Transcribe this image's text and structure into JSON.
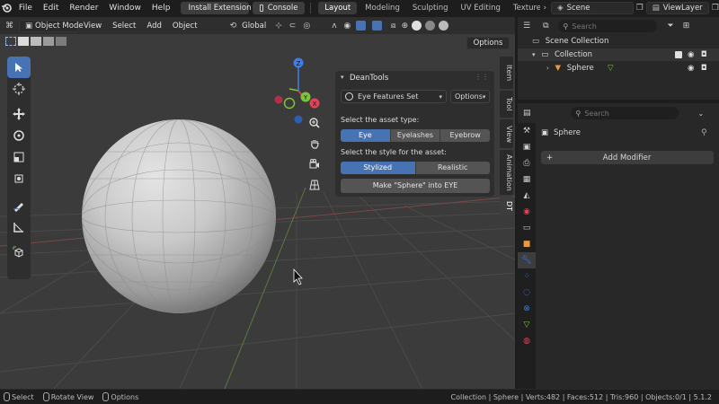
{
  "topbar": {
    "menus": [
      "File",
      "Edit",
      "Render",
      "Window",
      "Help"
    ],
    "install_extension": "Install Extension",
    "console": "Console",
    "workspaces": [
      "Layout",
      "Modeling",
      "Sculpting",
      "UV Editing",
      "Texture Pai"
    ],
    "active_workspace": "Layout",
    "scene": "Scene",
    "view_layer": "ViewLayer"
  },
  "viewport": {
    "mode": "Object Mode",
    "menus": [
      "View",
      "Select",
      "Add",
      "Object"
    ],
    "orientation": "Global",
    "options": "Options"
  },
  "gizmo": {
    "x": "X",
    "y": "Y",
    "z": "Z"
  },
  "npanel": {
    "title": "DeanTools",
    "feature_set": "Eye Features Set",
    "options": "Options",
    "asset_type_label": "Select the asset type:",
    "asset_types": [
      "Eye",
      "Eyelashes",
      "Eyebrow"
    ],
    "asset_selected": "Eye",
    "style_label": "Select the style for the asset:",
    "styles": [
      "Stylized",
      "Realistic"
    ],
    "style_selected": "Stylized",
    "make_button": "Make \"Sphere\" into EYE",
    "tabs": [
      "Item",
      "Tool",
      "View",
      "Animation",
      "DT"
    ],
    "active_tab": "DT"
  },
  "outliner": {
    "search_placeholder": "Search",
    "scene_collection": "Scene Collection",
    "collection": "Collection",
    "object": "Sphere"
  },
  "properties": {
    "search_placeholder": "Search",
    "object_name": "Sphere",
    "add_modifier": "Add Modifier"
  },
  "statusbar": {
    "select": "Select",
    "rotate_view": "Rotate View",
    "options": "Options",
    "stats": "Collection | Sphere | Verts:482 | Faces:512 | Tris:960 | Objects:0/1 | 5.1.2"
  },
  "colors": {
    "accent": "#4772b3",
    "viewport_bg": "#3b3b3b",
    "axis_x": "#e0445a",
    "axis_y": "#7ec33a",
    "axis_z": "#3e7ee8"
  }
}
